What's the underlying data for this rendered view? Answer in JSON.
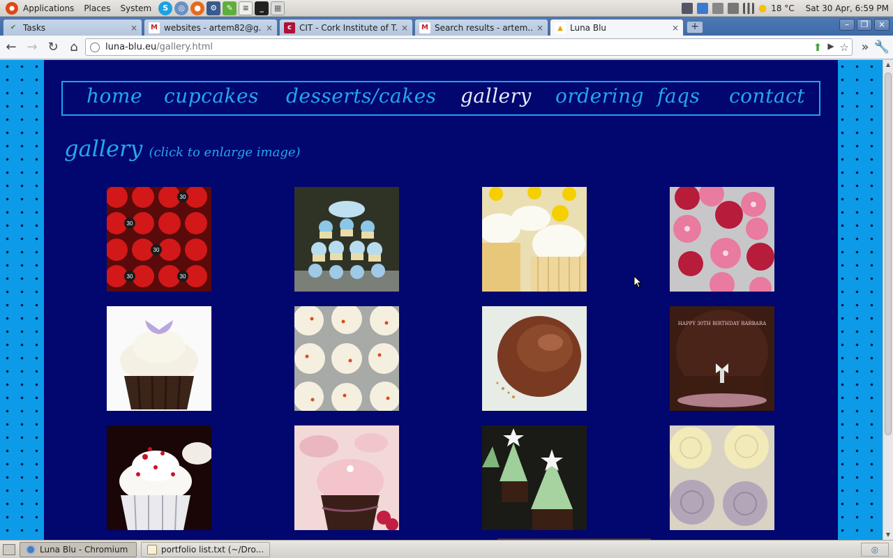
{
  "top_panel": {
    "menus": [
      "Applications",
      "Places",
      "System"
    ],
    "weather": "18 °C",
    "clock": "Sat 30 Apr,  6:59 PM"
  },
  "tabs": [
    {
      "title": "Tasks",
      "favicon": "checkmark-icon"
    },
    {
      "title": "websites - artem82@g...",
      "favicon": "gmail-icon"
    },
    {
      "title": "CIT - Cork Institute of T...",
      "favicon": "cit-icon"
    },
    {
      "title": "Search results - artem...",
      "favicon": "gmail-icon"
    },
    {
      "title": "Luna Blu",
      "favicon": "luna-blu-icon"
    }
  ],
  "toolbar": {
    "url_host": "luna-blu.eu",
    "url_path": "/gallery.html"
  },
  "site": {
    "nav": [
      "home",
      "cupcakes",
      "desserts/cakes",
      "gallery",
      "ordering",
      "faqs",
      "contact"
    ],
    "current_nav": "gallery",
    "heading": "gallery",
    "heading_note": "(click to enlarge image)",
    "images": [
      "red-heart-30-cupcakes",
      "cupcake-tower-blue",
      "yellow-flower-cupcakes",
      "pink-red-heart-cupcakes",
      "butterfly-chocolate-cupcake",
      "cream-star-cupcakes",
      "chocolate-frosted-cupcake",
      "30th-birthday-barbara-cake",
      "red-velvet-cupcake",
      "pink-rose-cupcake",
      "christmas-tree-star-cupcakes",
      "cream-lilac-swirl-cupcakes"
    ],
    "cake_text": "HAPPY 30TH BIRTHDAY BARBARA",
    "thumb_30": "30"
  },
  "bottom_panel": {
    "tasks": [
      "Luna Blu - Chromium",
      "portfolio list.txt (~/Dro..."
    ]
  },
  "colors": {
    "page_bg": "#02066f",
    "accent": "#22a8ef",
    "side_pattern": "#0c9be8"
  }
}
